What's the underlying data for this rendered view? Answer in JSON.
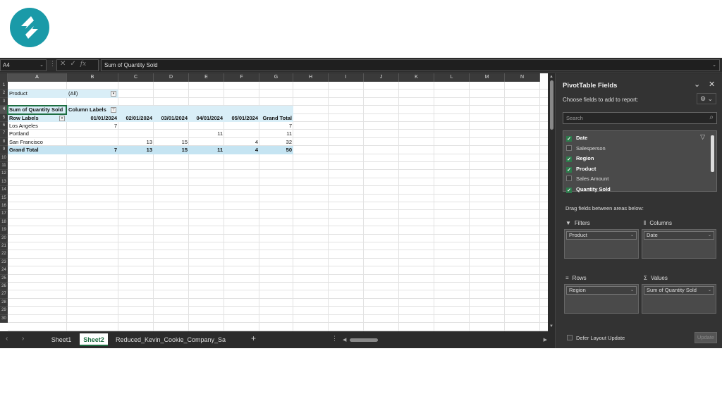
{
  "brand": {
    "logo_color": "#1a9aa8"
  },
  "formula_bar": {
    "name_box": "A4",
    "content": "Sum of Quantity Sold",
    "fx_label": "fx"
  },
  "columns": [
    "A",
    "B",
    "C",
    "D",
    "E",
    "F",
    "G",
    "H",
    "I",
    "J",
    "K",
    "L",
    "M",
    "N"
  ],
  "rows": [
    "1",
    "2",
    "3",
    "4",
    "5",
    "6",
    "7",
    "8",
    "9",
    "10",
    "11",
    "12",
    "13",
    "14",
    "15",
    "16",
    "17",
    "18",
    "19",
    "20",
    "21",
    "22",
    "23",
    "24",
    "25",
    "26",
    "27",
    "28",
    "29",
    "30"
  ],
  "pivot": {
    "filter_label": "Product",
    "filter_value": "(All)",
    "values_header": "Sum of Quantity Sold",
    "column_labels": "Column Labels",
    "row_labels": "Row Labels",
    "dates": [
      "01/01/2024",
      "02/01/2024",
      "03/01/2024",
      "04/01/2024",
      "05/01/2024"
    ],
    "grand_total_label": "Grand Total",
    "rows": [
      {
        "label": "Los Angeles",
        "values": [
          "7",
          "",
          "",
          "",
          "",
          "7"
        ]
      },
      {
        "label": "Portland",
        "values": [
          "",
          "",
          "",
          "11",
          "",
          "11"
        ]
      },
      {
        "label": "San Francisco",
        "values": [
          "",
          "13",
          "15",
          "",
          "4",
          "32"
        ]
      }
    ],
    "totals": [
      "7",
      "13",
      "15",
      "11",
      "4",
      "50"
    ]
  },
  "sheet_tabs": [
    "Sheet1",
    "Sheet2",
    "Reduced_Kevin_Cookie_Company_Sa"
  ],
  "active_tab": "Sheet2",
  "pane": {
    "title": "PivotTable Fields",
    "subtitle": "Choose fields to add to report:",
    "search_placeholder": "Search",
    "fields": [
      {
        "name": "Date",
        "checked": "✓"
      },
      {
        "name": "Salesperson",
        "checked": ""
      },
      {
        "name": "Region",
        "checked": "✓"
      },
      {
        "name": "Product",
        "checked": "✓"
      },
      {
        "name": "Sales Amount",
        "checked": ""
      },
      {
        "name": "Quantity Sold",
        "checked": "✓"
      }
    ],
    "drag_label": "Drag fields between areas below:",
    "areas": {
      "filters": {
        "label": "Filters",
        "item": "Product"
      },
      "columns": {
        "label": "Columns",
        "item": "Date"
      },
      "rows": {
        "label": "Rows",
        "item": "Region"
      },
      "values": {
        "label": "Values",
        "item": "Sum of Quantity Sold"
      }
    },
    "defer_label": "Defer Layout Update",
    "update_label": "Update"
  }
}
